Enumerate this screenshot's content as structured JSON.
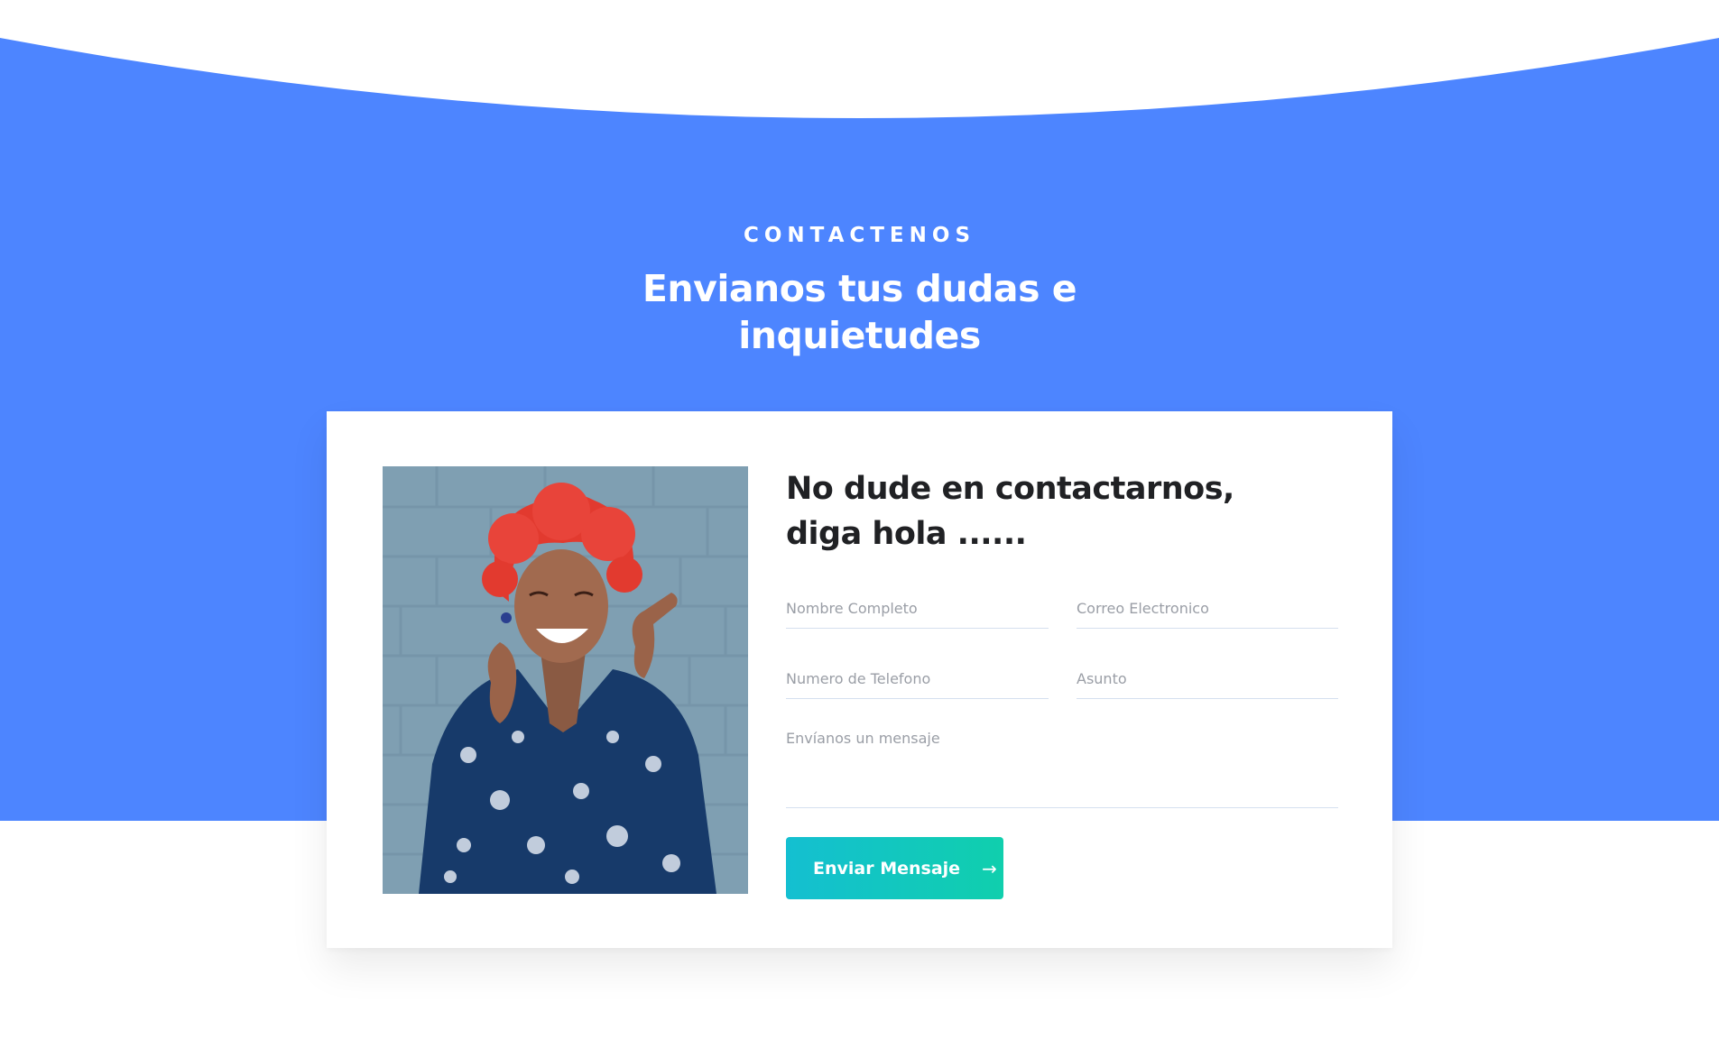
{
  "colors": {
    "band_blue": "#4d85ff",
    "button_gradient_start": "#14bfd1",
    "button_gradient_end": "#10cfad",
    "title_text": "#202124",
    "placeholder_text": "#9a9ea6"
  },
  "section": {
    "kicker": "CONTACTENOS",
    "headline": "Envianos tus dudas e inquietudes"
  },
  "form": {
    "title": "No dude en contactarnos, diga hola ......",
    "placeholders": {
      "name": "Nombre Completo",
      "email": "Correo Electronico",
      "phone": "Numero de Telefono",
      "subject": "Asunto",
      "message": "Envíanos un mensaje"
    },
    "submit_label": "Enviar Mensaje",
    "submit_icon": "arrow-right-icon",
    "submit_arrow": "→"
  },
  "photo": {
    "subject": "smiling-woman-photo"
  }
}
